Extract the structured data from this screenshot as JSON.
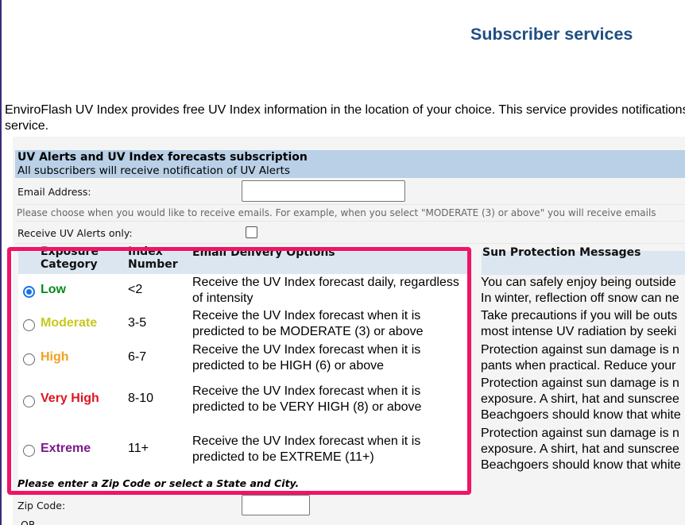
{
  "header": {
    "title": "Subscriber services"
  },
  "intro": {
    "line1": "EnviroFlash UV Index provides free UV Index information in the location of your choice. This service provides notifications",
    "line2": "service."
  },
  "form": {
    "section_title": "UV Alerts and UV Index forecasts subscription",
    "section_subtitle": "All subscribers will receive notification of UV Alerts",
    "email_label": "Email Address:",
    "email_value": "",
    "hint": "Please choose when you would like to receive emails. For example, when you select \"MODERATE (3) or above\" you will receive emails",
    "alerts_only_label": "Receive UV Alerts only:",
    "alerts_only_checked": false,
    "columns": {
      "exposure": "Exposure Category",
      "index": "Index Number",
      "delivery": "Email Delivery Options",
      "sun": "Sun Protection Messages"
    },
    "options": [
      {
        "category": "Low",
        "color": "#0b8a1f",
        "index": "<2",
        "selected": true,
        "delivery": "Receive the UV Index forecast daily, regardless of intensity",
        "sun": [
          "You can safely enjoy being outside",
          "In winter, reflection off snow can ne"
        ]
      },
      {
        "category": "Moderate",
        "color": "#c8c81e",
        "index": "3-5",
        "selected": false,
        "delivery": "Receive the UV Index forecast when it is predicted to be MODERATE (3) or above",
        "sun": [
          "Take precautions if you will be outs",
          "most intense UV radiation by seeki"
        ]
      },
      {
        "category": "High",
        "color": "#f0a020",
        "index": "6-7",
        "selected": false,
        "delivery": "Receive the UV Index forecast when it is predicted to be HIGH (6) or above",
        "sun": [
          "Protection against sun damage is n",
          "pants when practical. Reduce your"
        ]
      },
      {
        "category": "Very High",
        "color": "#e0141e",
        "index": "8-10",
        "selected": false,
        "delivery": "Receive the UV Index forecast when it is predicted to be VERY HIGH (8) or above",
        "sun": [
          "Protection against sun damage is n",
          "exposure. A shirt, hat and sunscree",
          "Beachgoers should know that white"
        ]
      },
      {
        "category": "Extreme",
        "color": "#7a1a8c",
        "index": "11+",
        "selected": false,
        "delivery": "Receive the UV Index forecast when it is predicted to be EXTREME (11+)",
        "sun": [
          "Protection against sun damage is n",
          "exposure. A shirt, hat and sunscree",
          "Beachgoers should know that white"
        ]
      }
    ],
    "zip_note": "Please enter a Zip Code or select a State and City.",
    "zip_label": "Zip Code:",
    "zip_value": "",
    "or_label": "OR"
  },
  "colors": {
    "title": "#1f4e82",
    "section_bg": "#b9d0e6",
    "highlight": "#ee1466"
  }
}
